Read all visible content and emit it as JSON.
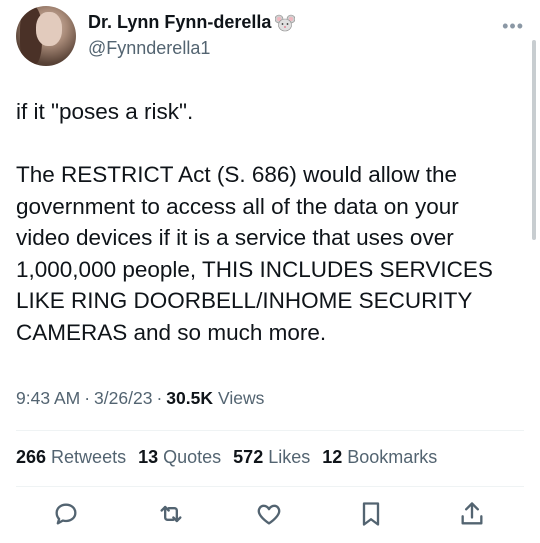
{
  "author": {
    "name": "Dr. Lynn Fynn-derella",
    "handle": "@Fynnderella1",
    "badge_icon": "mouse-face-emoji"
  },
  "tweet": {
    "text": "if it \"poses a risk\".\n\nThe RESTRICT Act (S. 686) would allow the government to access all of the data on your video devices if it is a service that uses over 1,000,000 people, THIS INCLUDES SERVICES LIKE RING DOORBELL/INHOME SECURITY CAMERAS and so much more."
  },
  "meta": {
    "time": "9:43 AM",
    "sep1": "·",
    "date": "3/26/23",
    "sep2": "·",
    "views_count": "30.5K",
    "views_label": "Views"
  },
  "stats": {
    "retweets_count": "266",
    "retweets_label": "Retweets",
    "quotes_count": "13",
    "quotes_label": "Quotes",
    "likes_count": "572",
    "likes_label": "Likes",
    "bookmarks_count": "12",
    "bookmarks_label": "Bookmarks"
  },
  "actions": [
    "reply-icon",
    "retweet-icon",
    "like-icon",
    "bookmark-icon",
    "share-icon"
  ],
  "colors": {
    "text": "#0f1419",
    "secondary": "#536471",
    "divider": "#eff3f4"
  }
}
